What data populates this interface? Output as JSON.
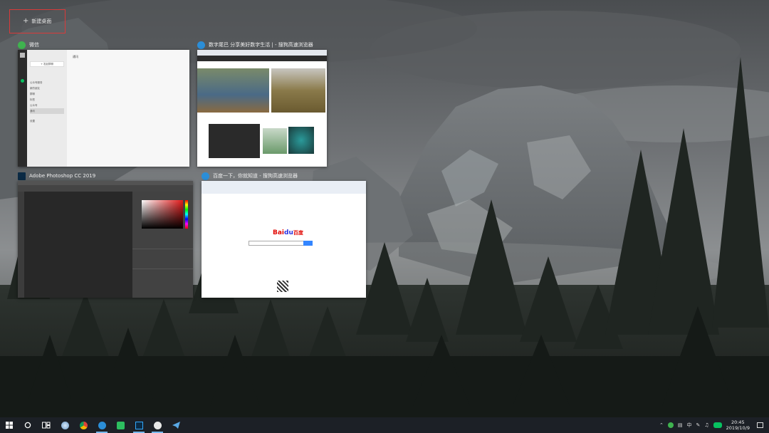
{
  "desktop": {
    "new_desktop_label": "新建桌面"
  },
  "windows": [
    {
      "title": "微信",
      "icon": "wechat-icon"
    },
    {
      "title": "数字尾巴 分享美好数字生活 | - 搜狗高速浏览器",
      "icon": "sogou-browser-icon"
    },
    {
      "title": "Adobe Photoshop CC 2019",
      "icon": "photoshop-icon"
    },
    {
      "title": "百度一下，你就知道 - 搜狗高速浏览器",
      "icon": "sogou-browser-icon"
    }
  ],
  "wechat_thumb": {
    "search_button": "+ 发起群聊",
    "header": "通讯",
    "items": [
      "公众号服务",
      "新的朋友",
      "群聊",
      "标签",
      "公众号",
      "通讯"
    ],
    "footer": "设置"
  },
  "baidu_thumb": {
    "logo_a": "Bai",
    "logo_b": "du",
    "logo_c": "百度"
  },
  "taskbar": {
    "apps": [
      "start-icon",
      "search-icon",
      "task-view-icon",
      "sogou-browser-icon",
      "chrome-icon",
      "sogou-browser-icon",
      "evernote-icon",
      "photoshop-icon",
      "wechat-icon",
      "telegram-icon"
    ],
    "tray_lang": "中",
    "time": "20:45",
    "date": "2019/10/9"
  },
  "colors": {
    "highlight_border": "#d93a3a",
    "taskbar_bg": "#1c2026",
    "active_indicator": "#76b9ed"
  }
}
